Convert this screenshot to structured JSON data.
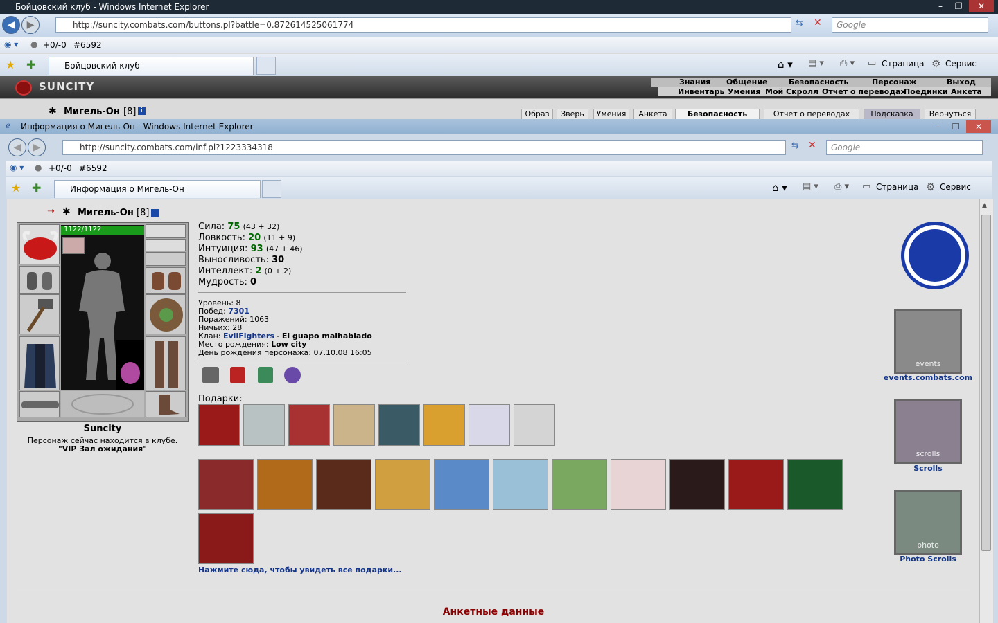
{
  "outer": {
    "title": "Бойцовский клуб - Windows Internet Explorer",
    "url": "http://suncity.combats.com/buttons.pl?battle=0.872614525061774",
    "search_placeholder": "Google",
    "cmd_counter": "+0/-0",
    "cmd_id": "#6592",
    "tab_label": "Бойцовский клуб",
    "toolbar_page": "Страница",
    "toolbar_service": "Сервис"
  },
  "game": {
    "logo": "SUNCITY",
    "menu1": [
      "Знания",
      "Общение",
      "Безопасность",
      "Персонаж",
      "Выход"
    ],
    "menu2": [
      "Инвентарь",
      "Умения",
      "Мой Скролл",
      "Отчет о переводах",
      "Поединки",
      "Анкета"
    ],
    "player_name": "Мигель-Он",
    "player_level": "[8]",
    "subtabs": [
      "Образ",
      "Зверь",
      "Умения",
      "Анкета",
      "Безопасность",
      "Отчет о переводах",
      "Подсказка",
      "Вернуться"
    ]
  },
  "inner": {
    "title": "Информация о Мигель-Он - Windows Internet Explorer",
    "url": "http://suncity.combats.com/inf.pl?1223334318",
    "search_placeholder": "Google",
    "cmd_counter": "+0/-0",
    "cmd_id": "#6592",
    "tab_label": "Информация о Мигель-Он",
    "toolbar_page": "Страница",
    "toolbar_service": "Сервис"
  },
  "profile": {
    "name": "Мигель-Он",
    "level": "[8]",
    "hp": "1122/1122",
    "hp_fraction": 1.0,
    "city": "Suncity",
    "location_text": "Персонаж сейчас находится в клубе.",
    "location_room": "\"VIP Зал ожидания\"",
    "stats": [
      {
        "label": "Сила:",
        "value": "75",
        "extra": "(43 + 32)"
      },
      {
        "label": "Ловкость:",
        "value": "20",
        "extra": "(11 + 9)"
      },
      {
        "label": "Интуиция:",
        "value": "93",
        "extra": "(47 + 46)"
      },
      {
        "label": "Выносливость:",
        "value": "30",
        "extra": ""
      },
      {
        "label": "Интеллект:",
        "value": "2",
        "extra": "(0 + 2)"
      },
      {
        "label": "Мудрость:",
        "value": "0",
        "extra": ""
      }
    ],
    "level_label": "Уровень:",
    "level_value": "8",
    "wins_label": "Побед:",
    "wins_value": "7301",
    "losses_label": "Поражений:",
    "losses_value": "1063",
    "draws_label": "Ничьих:",
    "draws_value": "28",
    "clan_label": "Клан:",
    "clan_name": "EvilFighters",
    "clan_sep": " - ",
    "clan_title": "El guapo malhablado",
    "birthplace_label": "Место рождения:",
    "birthplace_value": "Low city",
    "birthday_label": "День рождения персонажа:",
    "birthday_value": "07.10.08 16:05",
    "gifts_label": "Подарки:",
    "all_gifts_link": "Нажмите сюда, чтобы увидеть все подарки...",
    "section_title": "Анкетные данные"
  },
  "sidebar_links": {
    "events": "events.combats.com",
    "scrolls": "Scrolls",
    "photo": "Photo Scrolls",
    "events_banner": "events",
    "scrolls_banner": "scrolls",
    "photo_banner": "photo"
  },
  "colors": {
    "stat_green": "#006600",
    "link_blue": "#12358a",
    "section_red": "#8b0000",
    "hp_green": "#1a9a1a"
  }
}
